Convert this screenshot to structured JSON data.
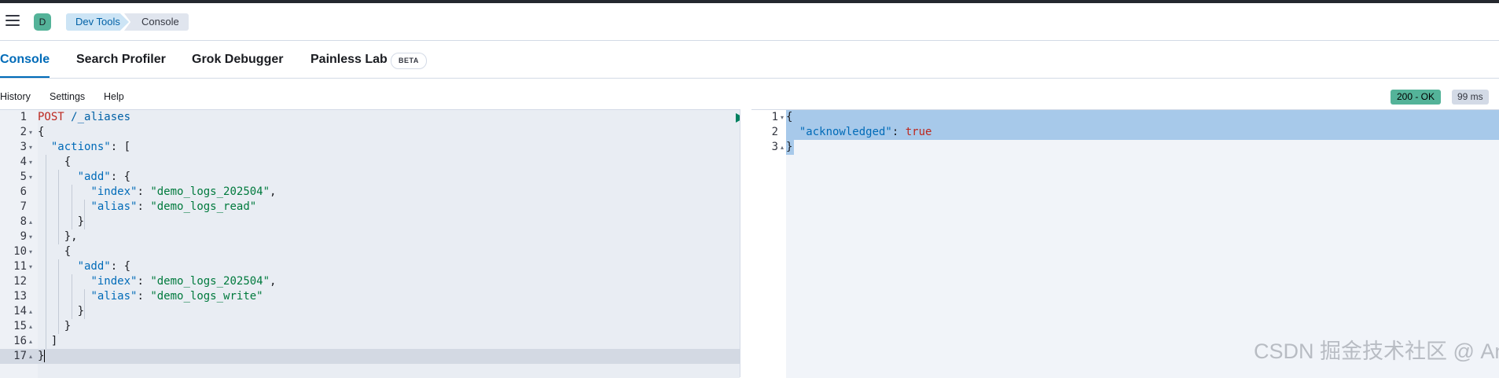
{
  "header": {
    "avatar_letter": "D",
    "breadcrumbs": [
      "Dev Tools",
      "Console"
    ]
  },
  "tabs": [
    {
      "label": "Console",
      "active": true
    },
    {
      "label": "Search Profiler",
      "active": false
    },
    {
      "label": "Grok Debugger",
      "active": false
    },
    {
      "label": "Painless Lab",
      "active": false
    }
  ],
  "beta_badge": "BETA",
  "toolbar": {
    "history": "History",
    "settings": "Settings",
    "help": "Help"
  },
  "response_status": {
    "status": "200 - OK",
    "time": "99 ms",
    "status_color": "#54b399"
  },
  "request": {
    "method": "POST",
    "url": "/_aliases",
    "line_numbers": [
      "1",
      "2",
      "3",
      "4",
      "5",
      "6",
      "7",
      "8",
      "9",
      "10",
      "11",
      "12",
      "13",
      "14",
      "15",
      "16",
      "17"
    ],
    "action1_index": "\"demo_logs_202504\"",
    "action1_alias": "\"demo_logs_read\"",
    "action2_index": "\"demo_logs_202504\"",
    "action2_alias": "\"demo_logs_write\"",
    "key_actions": "\"actions\"",
    "key_add": "\"add\"",
    "key_index": "\"index\"",
    "key_alias": "\"alias\""
  },
  "response": {
    "line_numbers": [
      "1",
      "2",
      "3"
    ],
    "key": "\"acknowledged\"",
    "value": "true"
  },
  "watermark": "CSDN 掘金技术社区 @ Andyat"
}
